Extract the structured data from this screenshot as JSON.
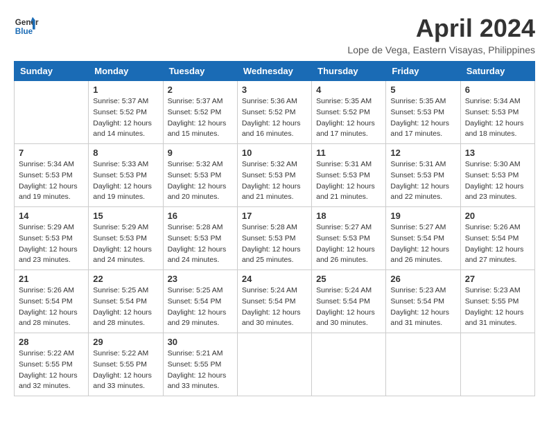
{
  "header": {
    "logo_line1": "General",
    "logo_line2": "Blue",
    "month": "April 2024",
    "location": "Lope de Vega, Eastern Visayas, Philippines"
  },
  "columns": [
    "Sunday",
    "Monday",
    "Tuesday",
    "Wednesday",
    "Thursday",
    "Friday",
    "Saturday"
  ],
  "weeks": [
    [
      {
        "day": "",
        "info": ""
      },
      {
        "day": "1",
        "info": "Sunrise: 5:37 AM\nSunset: 5:52 PM\nDaylight: 12 hours\nand 14 minutes."
      },
      {
        "day": "2",
        "info": "Sunrise: 5:37 AM\nSunset: 5:52 PM\nDaylight: 12 hours\nand 15 minutes."
      },
      {
        "day": "3",
        "info": "Sunrise: 5:36 AM\nSunset: 5:52 PM\nDaylight: 12 hours\nand 16 minutes."
      },
      {
        "day": "4",
        "info": "Sunrise: 5:35 AM\nSunset: 5:52 PM\nDaylight: 12 hours\nand 17 minutes."
      },
      {
        "day": "5",
        "info": "Sunrise: 5:35 AM\nSunset: 5:53 PM\nDaylight: 12 hours\nand 17 minutes."
      },
      {
        "day": "6",
        "info": "Sunrise: 5:34 AM\nSunset: 5:53 PM\nDaylight: 12 hours\nand 18 minutes."
      }
    ],
    [
      {
        "day": "7",
        "info": "Sunrise: 5:34 AM\nSunset: 5:53 PM\nDaylight: 12 hours\nand 19 minutes."
      },
      {
        "day": "8",
        "info": "Sunrise: 5:33 AM\nSunset: 5:53 PM\nDaylight: 12 hours\nand 19 minutes."
      },
      {
        "day": "9",
        "info": "Sunrise: 5:32 AM\nSunset: 5:53 PM\nDaylight: 12 hours\nand 20 minutes."
      },
      {
        "day": "10",
        "info": "Sunrise: 5:32 AM\nSunset: 5:53 PM\nDaylight: 12 hours\nand 21 minutes."
      },
      {
        "day": "11",
        "info": "Sunrise: 5:31 AM\nSunset: 5:53 PM\nDaylight: 12 hours\nand 21 minutes."
      },
      {
        "day": "12",
        "info": "Sunrise: 5:31 AM\nSunset: 5:53 PM\nDaylight: 12 hours\nand 22 minutes."
      },
      {
        "day": "13",
        "info": "Sunrise: 5:30 AM\nSunset: 5:53 PM\nDaylight: 12 hours\nand 23 minutes."
      }
    ],
    [
      {
        "day": "14",
        "info": "Sunrise: 5:29 AM\nSunset: 5:53 PM\nDaylight: 12 hours\nand 23 minutes."
      },
      {
        "day": "15",
        "info": "Sunrise: 5:29 AM\nSunset: 5:53 PM\nDaylight: 12 hours\nand 24 minutes."
      },
      {
        "day": "16",
        "info": "Sunrise: 5:28 AM\nSunset: 5:53 PM\nDaylight: 12 hours\nand 24 minutes."
      },
      {
        "day": "17",
        "info": "Sunrise: 5:28 AM\nSunset: 5:53 PM\nDaylight: 12 hours\nand 25 minutes."
      },
      {
        "day": "18",
        "info": "Sunrise: 5:27 AM\nSunset: 5:53 PM\nDaylight: 12 hours\nand 26 minutes."
      },
      {
        "day": "19",
        "info": "Sunrise: 5:27 AM\nSunset: 5:54 PM\nDaylight: 12 hours\nand 26 minutes."
      },
      {
        "day": "20",
        "info": "Sunrise: 5:26 AM\nSunset: 5:54 PM\nDaylight: 12 hours\nand 27 minutes."
      }
    ],
    [
      {
        "day": "21",
        "info": "Sunrise: 5:26 AM\nSunset: 5:54 PM\nDaylight: 12 hours\nand 28 minutes."
      },
      {
        "day": "22",
        "info": "Sunrise: 5:25 AM\nSunset: 5:54 PM\nDaylight: 12 hours\nand 28 minutes."
      },
      {
        "day": "23",
        "info": "Sunrise: 5:25 AM\nSunset: 5:54 PM\nDaylight: 12 hours\nand 29 minutes."
      },
      {
        "day": "24",
        "info": "Sunrise: 5:24 AM\nSunset: 5:54 PM\nDaylight: 12 hours\nand 30 minutes."
      },
      {
        "day": "25",
        "info": "Sunrise: 5:24 AM\nSunset: 5:54 PM\nDaylight: 12 hours\nand 30 minutes."
      },
      {
        "day": "26",
        "info": "Sunrise: 5:23 AM\nSunset: 5:54 PM\nDaylight: 12 hours\nand 31 minutes."
      },
      {
        "day": "27",
        "info": "Sunrise: 5:23 AM\nSunset: 5:55 PM\nDaylight: 12 hours\nand 31 minutes."
      }
    ],
    [
      {
        "day": "28",
        "info": "Sunrise: 5:22 AM\nSunset: 5:55 PM\nDaylight: 12 hours\nand 32 minutes."
      },
      {
        "day": "29",
        "info": "Sunrise: 5:22 AM\nSunset: 5:55 PM\nDaylight: 12 hours\nand 33 minutes."
      },
      {
        "day": "30",
        "info": "Sunrise: 5:21 AM\nSunset: 5:55 PM\nDaylight: 12 hours\nand 33 minutes."
      },
      {
        "day": "",
        "info": ""
      },
      {
        "day": "",
        "info": ""
      },
      {
        "day": "",
        "info": ""
      },
      {
        "day": "",
        "info": ""
      }
    ]
  ]
}
